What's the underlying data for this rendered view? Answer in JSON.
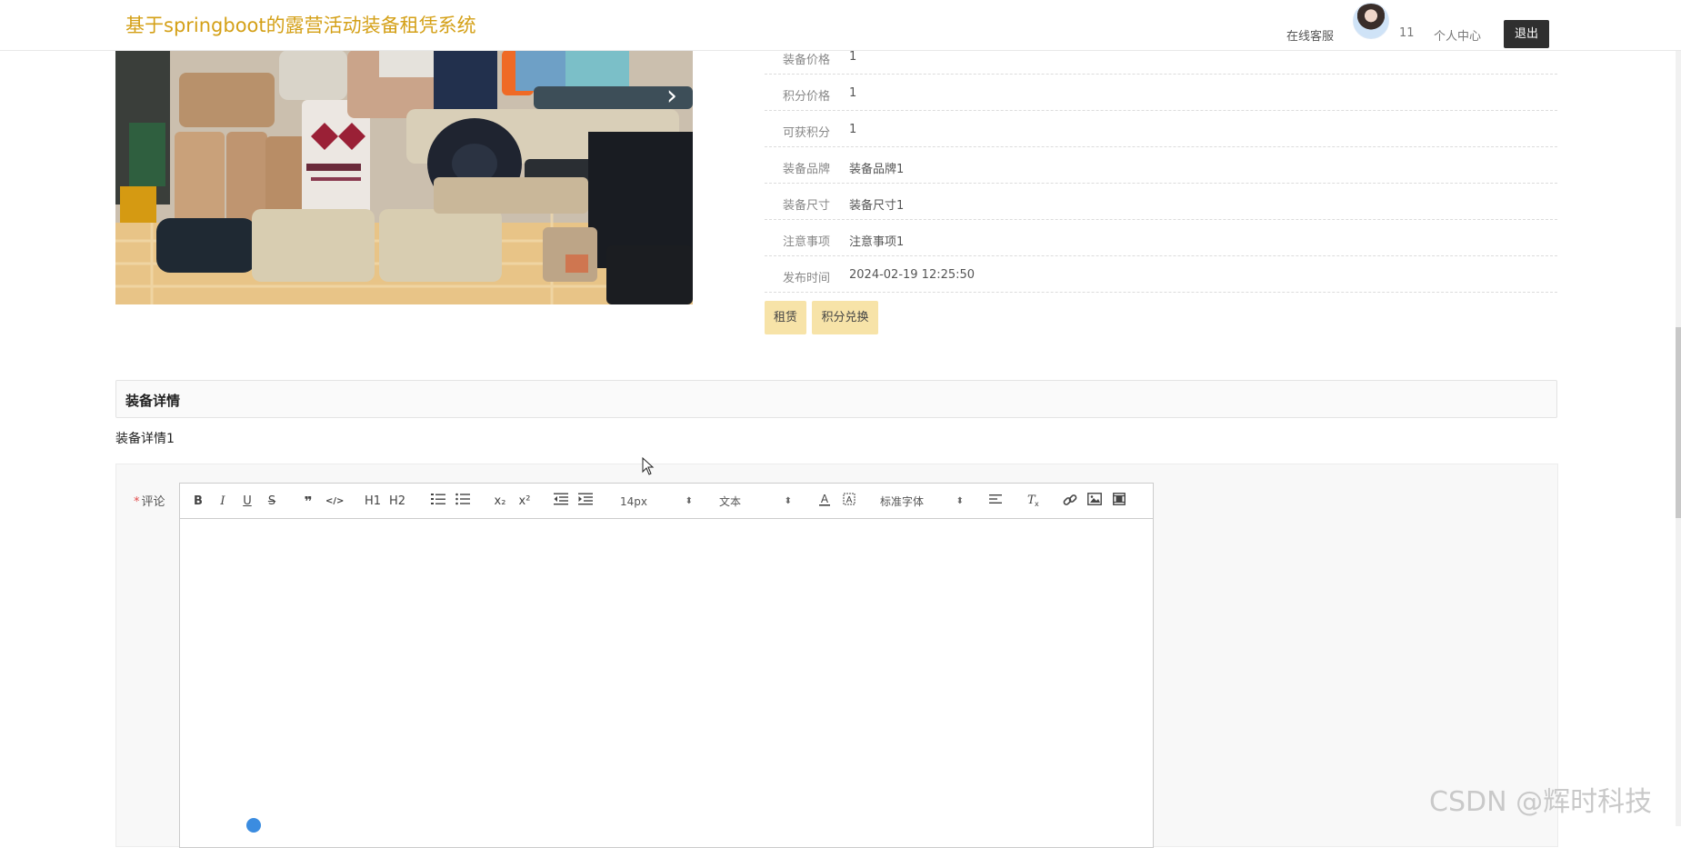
{
  "header": {
    "site_title": "基于springboot的露营活动装备租凭系统",
    "online_service": "在线客服",
    "username": "11",
    "personal_center": "个人中心",
    "logout": "退出"
  },
  "product": {
    "carousel_next_icon": "chevron-right-icon",
    "details": [
      {
        "label": "装备价格",
        "value": "1"
      },
      {
        "label": "积分价格",
        "value": "1"
      },
      {
        "label": "可获积分",
        "value": "1"
      },
      {
        "label": "装备品牌",
        "value": "装备品牌1"
      },
      {
        "label": "装备尺寸",
        "value": "装备尺寸1"
      },
      {
        "label": "注意事项",
        "value": "注意事项1"
      },
      {
        "label": "发布时间",
        "value": "2024-02-19 12:25:50"
      }
    ],
    "buttons": {
      "rent": "租赁",
      "points_exchange": "积分兑换"
    }
  },
  "detail_section": {
    "title": "装备详情",
    "content": "装备详情1"
  },
  "comment_form": {
    "required_mark": "*",
    "label": "评论",
    "toolbar": {
      "bold": "B",
      "italic": "I",
      "underline": "U",
      "strike": "S",
      "blockquote": "❞",
      "code": "</>",
      "h1": "H1",
      "h2": "H2",
      "subscript": "x₂",
      "superscript": "x²",
      "font_size": "14px",
      "header_select": "文本",
      "font_family": "标准字体"
    }
  },
  "watermark": "CSDN @辉时科技",
  "colors": {
    "title": "#d4a017",
    "action_button": "#f7e3a8",
    "logout_bg": "#2f2f2f"
  }
}
